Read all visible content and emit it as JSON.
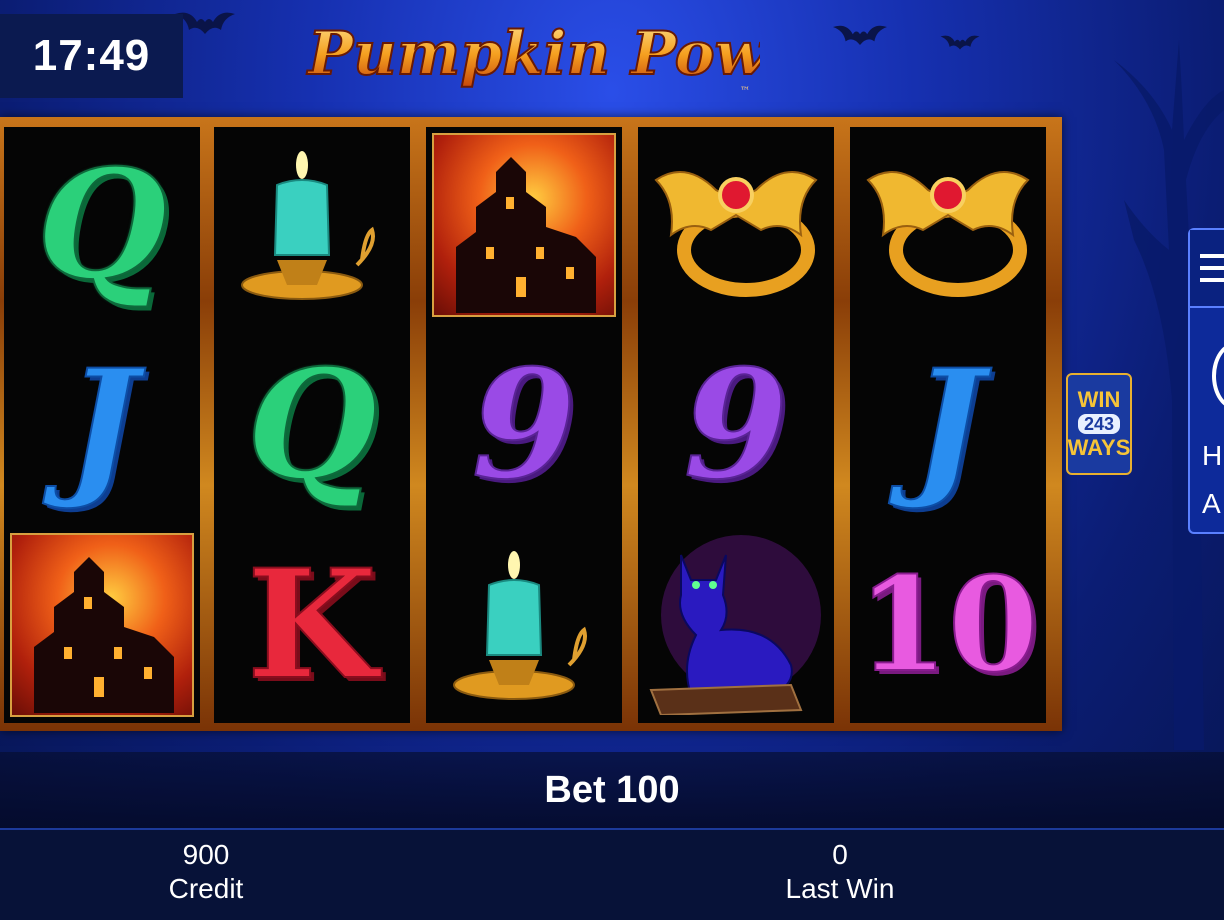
{
  "clock": "17:49",
  "game_title": "Pumpkin Power",
  "trademark": "™",
  "reels": [
    [
      "Q",
      "J",
      "haunted-house"
    ],
    [
      "candle",
      "Q",
      "K"
    ],
    [
      "haunted-house",
      "9",
      "candle"
    ],
    [
      "bat-ring",
      "9",
      "black-cat"
    ],
    [
      "bat-ring",
      "J",
      "10"
    ]
  ],
  "ways_badge": {
    "top": "WIN",
    "number": "243",
    "bottom": "WAYS"
  },
  "side_panel": {
    "line1": "H",
    "line2": "A"
  },
  "bet": {
    "label": "Bet 100"
  },
  "credit": {
    "value": "900",
    "label": "Credit"
  },
  "last_win": {
    "value": "0",
    "label": "Last Win"
  },
  "colors": {
    "frame": "#c8751a",
    "background": "#1630b0",
    "reel_bg": "#050505"
  }
}
